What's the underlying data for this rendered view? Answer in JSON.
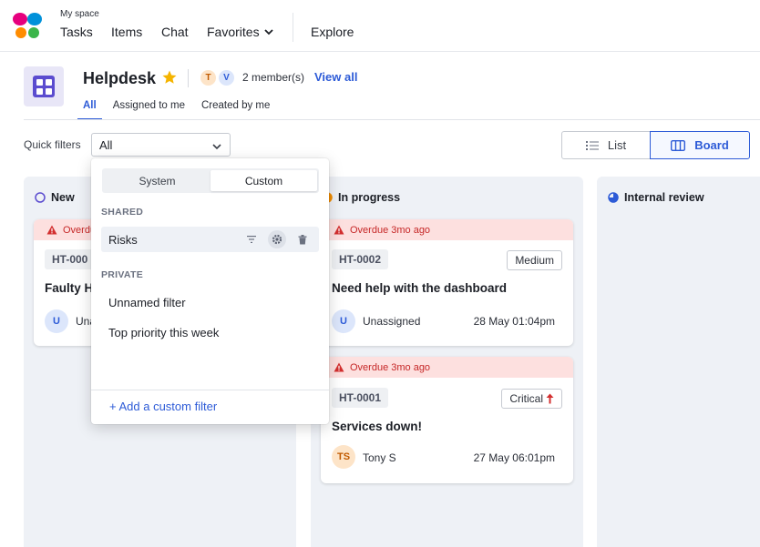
{
  "nav": {
    "space_label": "My space",
    "items": [
      {
        "label": "Tasks"
      },
      {
        "label": "Items"
      },
      {
        "label": "Chat"
      },
      {
        "label": "Favorites"
      },
      {
        "label": "Explore"
      }
    ]
  },
  "header": {
    "title": "Helpdesk",
    "member_initials": [
      "T",
      "V"
    ],
    "members_text": "2 member(s)",
    "view_all": "View all",
    "tabs": [
      {
        "label": "All",
        "active": true
      },
      {
        "label": "Assigned to me",
        "active": false
      },
      {
        "label": "Created by me",
        "active": false
      }
    ]
  },
  "filters": {
    "label": "Quick filters",
    "selected": "All"
  },
  "view_toggle": {
    "list_label": "List",
    "board_label": "Board",
    "active": "Board"
  },
  "popover": {
    "tabs": [
      {
        "label": "System",
        "active": false
      },
      {
        "label": "Custom",
        "active": true
      }
    ],
    "shared_heading": "SHARED",
    "shared_items": [
      {
        "label": "Risks"
      }
    ],
    "private_heading": "PRIVATE",
    "private_items": [
      {
        "label": "Unnamed filter"
      },
      {
        "label": "Top priority this week"
      }
    ],
    "add_label": "+ Add a custom filter"
  },
  "columns": {
    "new": {
      "title": "New",
      "card": {
        "banner": "Overdue",
        "id": "HT-000",
        "title": "Faulty H",
        "assignee_initial": "U",
        "assignee": "Una"
      }
    },
    "in_progress": {
      "title": "In progress",
      "cards": [
        {
          "banner": "Overdue 3mo ago",
          "id": "HT-0002",
          "priority": "Medium",
          "title": "Need help with the dashboard",
          "assignee_initial": "U",
          "assignee": "Unassigned",
          "due": "28 May 01:04pm"
        },
        {
          "banner": "Overdue 3mo ago",
          "id": "HT-0001",
          "priority": "Critical",
          "title": "Services down!",
          "assignee_initial": "TS",
          "assignee": "Tony S",
          "due": "27 May 06:01pm"
        }
      ]
    },
    "internal_review": {
      "title": "Internal review"
    }
  },
  "colors": {
    "accent": "#2d5bd7",
    "overdue_bg": "#fde0df",
    "overdue_text": "#c62828",
    "column_bg": "#eef1f6",
    "app_tile": "#5b4ccf"
  },
  "icons": [
    "butterfly-logo-icon",
    "chevron-down-icon",
    "star-icon",
    "list-icon",
    "board-icon",
    "status-circle-icon",
    "warning-icon",
    "filter-icon",
    "gear-icon",
    "trash-icon",
    "arrow-up-icon"
  ]
}
